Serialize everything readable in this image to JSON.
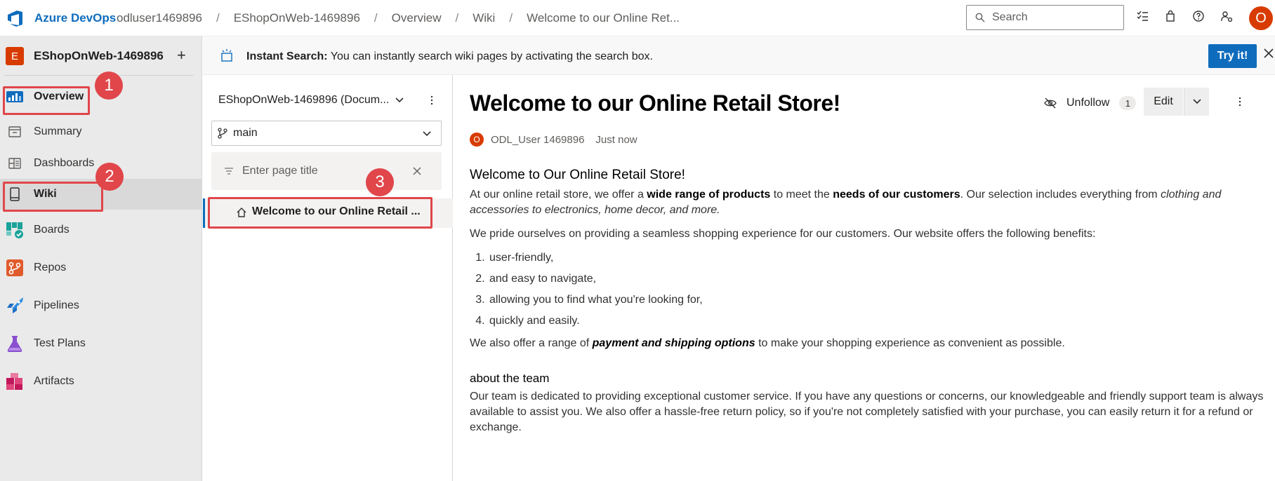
{
  "topbar": {
    "brand": "Azure DevOps",
    "breadcrumbs": [
      "odluser1469896",
      "EShopOnWeb-1469896",
      "Overview",
      "Wiki",
      "Welcome to our Online Ret..."
    ],
    "search_placeholder": "Search",
    "user_initial": "O",
    "icons": [
      "task-list-icon",
      "shopping-bag-icon",
      "help-icon",
      "user-settings-icon"
    ]
  },
  "project": {
    "initial": "E",
    "name": "EShopOnWeb-1469896",
    "add": "+"
  },
  "nav": {
    "items": [
      {
        "label": "Overview",
        "icon": "overview-icon"
      },
      {
        "label": "Summary",
        "icon": "summary-icon"
      },
      {
        "label": "Dashboards",
        "icon": "dashboards-icon"
      },
      {
        "label": "Wiki",
        "icon": "wiki-icon"
      },
      {
        "label": "Boards",
        "icon": "boards-icon"
      },
      {
        "label": "Repos",
        "icon": "repos-icon"
      },
      {
        "label": "Pipelines",
        "icon": "pipelines-icon"
      },
      {
        "label": "Test Plans",
        "icon": "test-plans-icon"
      },
      {
        "label": "Artifacts",
        "icon": "artifacts-icon"
      }
    ]
  },
  "annotations": [
    "1",
    "2",
    "3"
  ],
  "infobar": {
    "bold": "Instant Search:",
    "text": " You can instantly search wiki pages by activating the search box.",
    "button": "Try it!"
  },
  "tree": {
    "wiki_name": "EShopOnWeb-1469896 (Docum...",
    "branch": "main",
    "filter_placeholder": "Enter page title",
    "page": "Welcome to our Online Retail ..."
  },
  "page": {
    "title": "Welcome to our Online Retail Store!",
    "unfollow": "Unfollow",
    "followers": "1",
    "edit": "Edit",
    "author_initial": "O",
    "author": "ODL_User 1469896",
    "when": "Just now",
    "heading": "Welcome to Our Online Retail Store!",
    "p1_a": "At our online retail store, we offer a ",
    "p1_b1": "wide range of products",
    "p1_c": " to meet the ",
    "p1_b2": "needs of our customers",
    "p1_d": ". Our selection includes everything from ",
    "p1_i": "clothing and accessories to electronics, home decor, and more.",
    "p2": "We pride ourselves on providing a seamless shopping experience for our customers. Our website offers the following benefits:",
    "list": [
      "user-friendly,",
      "and easy to navigate,",
      "allowing you to find what you're looking for,",
      "quickly and easily."
    ],
    "p3_a": "We also offer a range of ",
    "p3_bi": "payment and shipping options",
    "p3_c": " to make your shopping experience as convenient as possible.",
    "sub": "about the team",
    "p4": "Our team is dedicated to providing exceptional customer service. If you have any questions or concerns, our knowledgeable and friendly support team is always available to assist you. We also offer a hassle-free return policy, so if you're not completely satisfied with your purchase, you can easily return it for a refund or exchange."
  },
  "colors": {
    "accent": "#0f6cbd",
    "annotation": "#e0464a",
    "avatar": "#d83b01"
  }
}
